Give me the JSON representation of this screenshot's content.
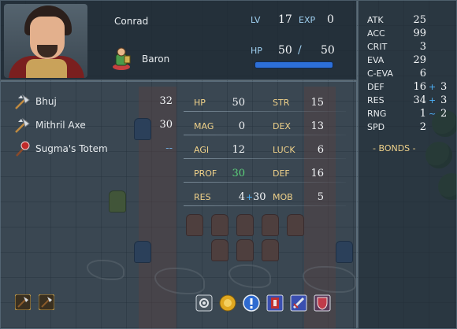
{
  "unit": {
    "name": "Conrad",
    "class": "Baron",
    "lv_label": "LV",
    "lv": "17",
    "exp_label": "EXP",
    "exp": "0",
    "hp_label": "HP",
    "hp_current": "50",
    "hp_sep": "/",
    "hp_max": "50",
    "hp_fill": 1.0
  },
  "inventory": [
    {
      "icon": "axe-icon",
      "name": "Bhuj",
      "uses": "32"
    },
    {
      "icon": "axe-icon",
      "name": "Mithril Axe",
      "uses": "30"
    },
    {
      "icon": "totem-icon",
      "name": "Sugma's Totem",
      "uses": "--"
    }
  ],
  "stats_left": [
    {
      "label": "HP",
      "value": "50"
    },
    {
      "label": "MAG",
      "value": "0"
    },
    {
      "label": "AGI",
      "value": "12"
    },
    {
      "label": "PROF",
      "value": "30",
      "highlight": "#5cd17a"
    },
    {
      "label": "RES",
      "value": "4",
      "bonus_plus": "+",
      "bonus": "30"
    }
  ],
  "stats_right": [
    {
      "label": "STR",
      "value": "15"
    },
    {
      "label": "DEX",
      "value": "13"
    },
    {
      "label": "LUCK",
      "value": "6"
    },
    {
      "label": "DEF",
      "value": "16"
    },
    {
      "label": "MOB",
      "value": "5"
    }
  ],
  "combat": [
    {
      "label": "ATK",
      "value": "25"
    },
    {
      "label": "ACC",
      "value": "99"
    },
    {
      "label": "CRIT",
      "value": "3"
    },
    {
      "label": "EVA",
      "value": "29"
    },
    {
      "label": "C-EVA",
      "value": "6"
    },
    {
      "label": "DEF",
      "value": "16",
      "plus": "+",
      "bonus": "3"
    },
    {
      "label": "RES",
      "value": "34",
      "plus": "+",
      "bonus": "3"
    },
    {
      "label": "RNG",
      "value": "1",
      "plus": "~",
      "bonus": "2"
    },
    {
      "label": "SPD",
      "value": "2"
    }
  ],
  "bonds_label": "- BONDS -",
  "weapon_ranks": [
    "axe-rank-icon",
    "axe-rank-icon"
  ],
  "skills": [
    "gear-skill-icon",
    "shield-skill-icon",
    "exclamation-skill-icon",
    "red-banner-skill-icon",
    "sword-skill-icon",
    "red-shield-skill-icon"
  ],
  "colors": {
    "hp_bar": "#2d6fd8",
    "label_blue": "#9fd0f0",
    "label_gold": "#f0d28a",
    "bonus_blue": "#4fb6ff",
    "prof_green": "#5cd17a"
  }
}
